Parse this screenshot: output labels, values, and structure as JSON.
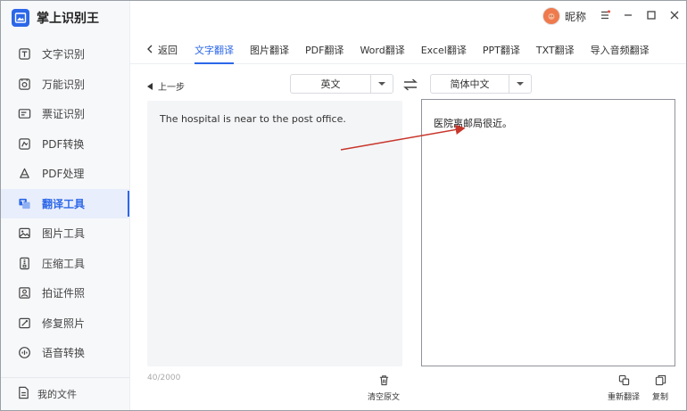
{
  "app": {
    "title": "掌上识别王"
  },
  "sidebar": {
    "items": [
      {
        "label": "文字识别",
        "icon": "text-recognition-icon"
      },
      {
        "label": "万能识别",
        "icon": "universal-recognition-icon"
      },
      {
        "label": "票证识别",
        "icon": "ticket-recognition-icon"
      },
      {
        "label": "PDF转换",
        "icon": "pdf-convert-icon"
      },
      {
        "label": "PDF处理",
        "icon": "pdf-process-icon"
      },
      {
        "label": "翻译工具",
        "icon": "translate-tool-icon",
        "active": true
      },
      {
        "label": "图片工具",
        "icon": "image-tool-icon"
      },
      {
        "label": "压缩工具",
        "icon": "compress-tool-icon"
      },
      {
        "label": "拍证件照",
        "icon": "id-photo-icon"
      },
      {
        "label": "修复照片",
        "icon": "photo-repair-icon"
      },
      {
        "label": "语音转换",
        "icon": "voice-convert-icon"
      }
    ],
    "my_files": "我的文件"
  },
  "user": {
    "nickname": "昵称"
  },
  "tabs": {
    "back": "返回",
    "items": [
      "文字翻译",
      "图片翻译",
      "PDF翻译",
      "Word翻译",
      "Excel翻译",
      "PPT翻译",
      "TXT翻译",
      "导入音频翻译"
    ],
    "active_index": 0
  },
  "toolbar": {
    "prev_step": "上一步",
    "source_lang": "英文",
    "target_lang": "简体中文"
  },
  "source": {
    "text": "The hospital is near to the post office.",
    "counter": "40/2000",
    "clear_label": "清空原文"
  },
  "result": {
    "text": "医院离邮局很近。",
    "retranslate_label": "重新翻译",
    "copy_label": "复制"
  },
  "colors": {
    "accent": "#2c67e8",
    "annotation_arrow": "#c8362b",
    "avatar": "#ef7a4e"
  }
}
